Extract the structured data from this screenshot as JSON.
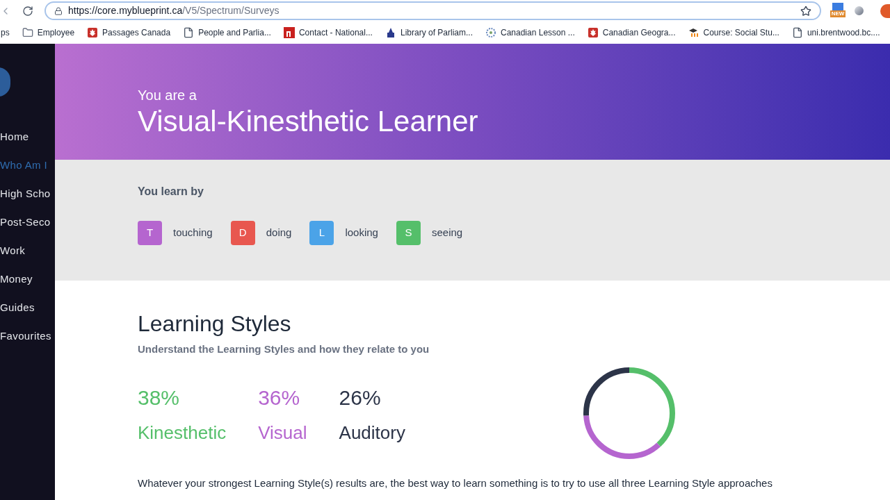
{
  "browser": {
    "url_host": "https://core.myblueprint.ca",
    "url_path": "/V5/Spectrum/Surveys",
    "new_badge": "NEW",
    "bookmarks": [
      {
        "label": "ps",
        "kind": "none"
      },
      {
        "label": "Employee",
        "kind": "folder"
      },
      {
        "label": "Passages Canada",
        "kind": "leaf"
      },
      {
        "label": "People and Parlia...",
        "kind": "page"
      },
      {
        "label": "Contact - National...",
        "kind": "n"
      },
      {
        "label": "Library of Parliam...",
        "kind": "building"
      },
      {
        "label": "Canadian Lesson ...",
        "kind": "flower"
      },
      {
        "label": "Canadian Geogra...",
        "kind": "leaf"
      },
      {
        "label": "Course: Social Stu...",
        "kind": "cap"
      },
      {
        "label": "uni.brentwood.bc....",
        "kind": "page"
      }
    ]
  },
  "sidebar": {
    "items": [
      {
        "label": "Home",
        "selected": false
      },
      {
        "label": "Who Am I",
        "selected": true
      },
      {
        "label": "High Scho",
        "selected": false
      },
      {
        "label": "Post-Seco",
        "selected": false
      },
      {
        "label": "Work",
        "selected": false
      },
      {
        "label": "Money",
        "selected": false
      },
      {
        "label": "Guides",
        "selected": false
      },
      {
        "label": "Favourites",
        "selected": false
      }
    ]
  },
  "hero": {
    "kicker": "You are a",
    "title": "Visual-Kinesthetic Learner"
  },
  "learn_by": {
    "heading": "You learn by",
    "items": [
      {
        "letter": "T",
        "label": "touching",
        "color": "#b565cf"
      },
      {
        "letter": "D",
        "label": "doing",
        "color": "#e8574f"
      },
      {
        "letter": "L",
        "label": "looking",
        "color": "#4ba3e8"
      },
      {
        "letter": "S",
        "label": "seeing",
        "color": "#55bf6a"
      }
    ]
  },
  "styles": {
    "title": "Learning Styles",
    "subtitle": "Understand the Learning Styles and how they relate to you",
    "items": [
      {
        "percent": "38%",
        "name": "Kinesthetic",
        "color": "#55bf6a"
      },
      {
        "percent": "36%",
        "name": "Visual",
        "color": "#b565cf"
      },
      {
        "percent": "26%",
        "name": "Auditory",
        "color": "#2c3448"
      }
    ],
    "body": "Whatever your strongest Learning Style(s) results are, the best way to learn something is to try to use all three Learning Style approaches"
  }
}
